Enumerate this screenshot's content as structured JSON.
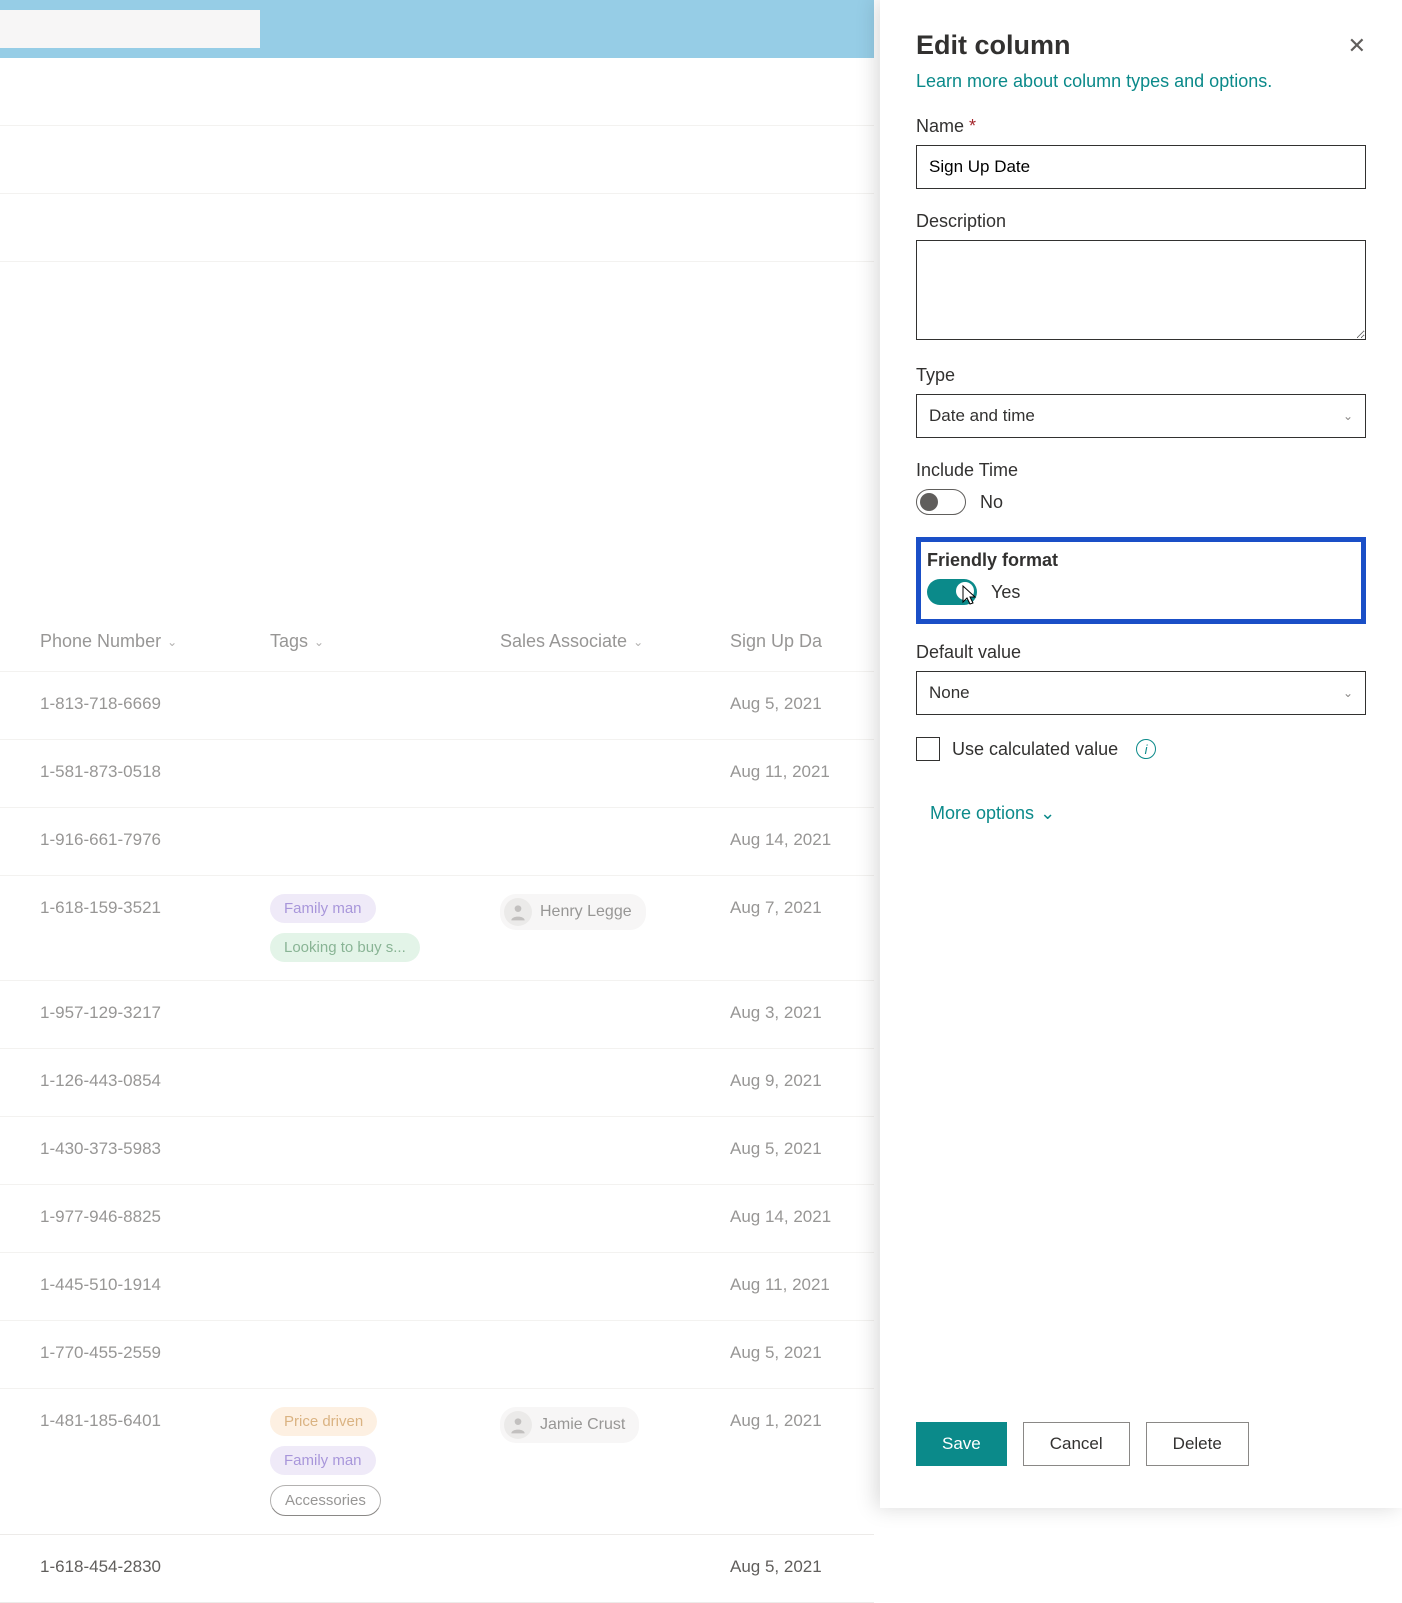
{
  "columns": {
    "phone": "Phone Number",
    "tags": "Tags",
    "assoc": "Sales Associate",
    "date": "Sign Up Da"
  },
  "rows": [
    {
      "phone": "1-813-718-6669",
      "tags": [],
      "assoc": "",
      "date": "Aug 5, 2021"
    },
    {
      "phone": "1-581-873-0518",
      "tags": [],
      "assoc": "",
      "date": "Aug 11, 2021"
    },
    {
      "phone": "1-916-661-7976",
      "tags": [],
      "assoc": "",
      "date": "Aug 14, 2021"
    },
    {
      "phone": "1-618-159-3521",
      "tags": [
        {
          "t": "Family man",
          "c": "purple"
        },
        {
          "t": "Looking to buy s...",
          "c": "green"
        }
      ],
      "assoc": "Henry Legge",
      "date": "Aug 7, 2021"
    },
    {
      "phone": "1-957-129-3217",
      "tags": [],
      "assoc": "",
      "date": "Aug 3, 2021"
    },
    {
      "phone": "1-126-443-0854",
      "tags": [],
      "assoc": "",
      "date": "Aug 9, 2021"
    },
    {
      "phone": "1-430-373-5983",
      "tags": [],
      "assoc": "",
      "date": "Aug 5, 2021"
    },
    {
      "phone": "1-977-946-8825",
      "tags": [],
      "assoc": "",
      "date": "Aug 14, 2021"
    },
    {
      "phone": "1-445-510-1914",
      "tags": [],
      "assoc": "",
      "date": "Aug 11, 2021"
    },
    {
      "phone": "1-770-455-2559",
      "tags": [],
      "assoc": "",
      "date": "Aug 5, 2021"
    },
    {
      "phone": "1-481-185-6401",
      "tags": [
        {
          "t": "Price driven",
          "c": "orange"
        },
        {
          "t": "Family man",
          "c": "purple"
        },
        {
          "t": "Accessories",
          "c": "outline"
        }
      ],
      "assoc": "Jamie Crust",
      "date": "Aug 1, 2021"
    },
    {
      "phone": "1-618-454-2830",
      "tags": [],
      "assoc": "",
      "date": "Aug 5, 2021"
    }
  ],
  "panel": {
    "title": "Edit column",
    "learn_link": "Learn more about column types and options.",
    "name_label": "Name",
    "name_value": "Sign Up Date",
    "desc_label": "Description",
    "desc_value": "",
    "type_label": "Type",
    "type_value": "Date and time",
    "include_time_label": "Include Time",
    "include_time_value": "No",
    "friendly_label": "Friendly format",
    "friendly_value": "Yes",
    "default_label": "Default value",
    "default_value": "None",
    "calc_label": "Use calculated value",
    "more_options": "More options",
    "save": "Save",
    "cancel": "Cancel",
    "delete": "Delete"
  }
}
